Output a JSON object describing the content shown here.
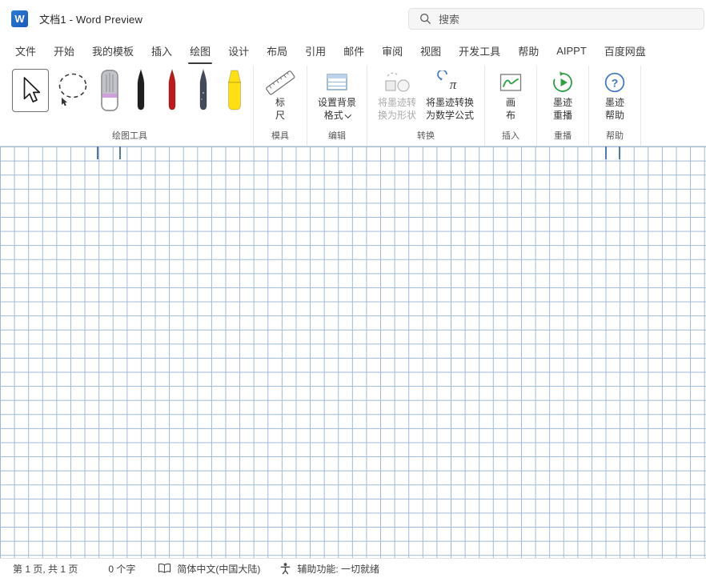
{
  "titlebar": {
    "app_initial": "W",
    "title": "文档1  -  Word Preview",
    "search_label": "搜索"
  },
  "tabs": [
    "文件",
    "开始",
    "我的模板",
    "插入",
    "绘图",
    "设计",
    "布局",
    "引用",
    "邮件",
    "审阅",
    "视图",
    "开发工具",
    "帮助",
    "AIPPT",
    "百度网盘"
  ],
  "ribbon": {
    "group_labels": {
      "drawing_tools": "绘图工具",
      "stencils": "模具",
      "edit": "编辑",
      "convert": "转换",
      "insert": "插入",
      "replay": "重播",
      "help": "帮助"
    },
    "buttons": {
      "ruler": {
        "line1": "标",
        "line2": "尺"
      },
      "format_background": {
        "line1": "设置背景",
        "line2": "格式"
      },
      "ink_to_shape": {
        "line1": "将墨迹转",
        "line2": "换为形状"
      },
      "ink_to_math": {
        "line1": "将墨迹转换",
        "line2": "为数学公式"
      },
      "canvas": {
        "line1": "画",
        "line2": "布"
      },
      "ink_replay": {
        "line1": "墨迹",
        "line2": "重播"
      },
      "ink_help": {
        "line1": "墨迹",
        "line2": "帮助"
      }
    },
    "icons": {
      "pi": "π",
      "question": "?"
    },
    "pen_colors": {
      "black": "#1f1f1f",
      "red": "#c11818",
      "galaxy": "#434a5c",
      "highlighter": "#ffe012"
    }
  },
  "statusbar": {
    "page_info": "第 1 页, 共 1 页",
    "word_count": "0 个字",
    "language": "简体中文(中国大陆)",
    "accessibility": "辅助功能: 一切就绪"
  },
  "colors": {
    "word_blue": "#185abd",
    "grid_line": "#9fb8d8",
    "tab_underline": "#3b3b3b"
  }
}
